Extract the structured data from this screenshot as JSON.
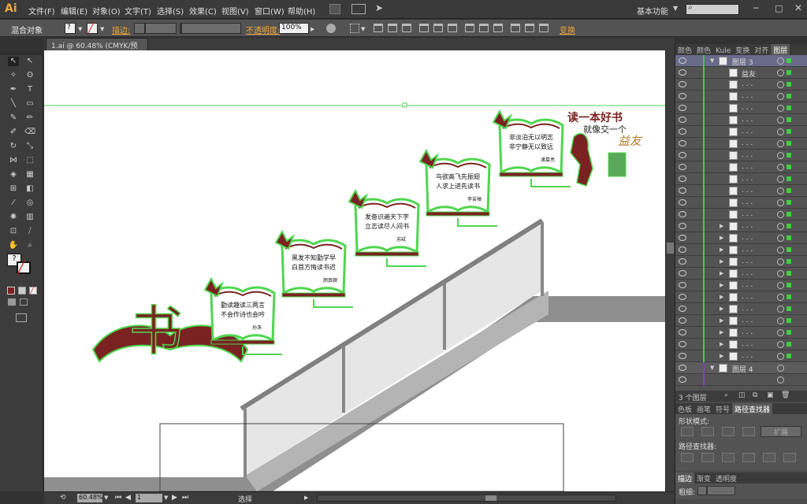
{
  "app": {
    "logo": "Ai",
    "accent": "#f0a63a",
    "workspace": "基本功能"
  },
  "menu": [
    "文件(F)",
    "编辑(E)",
    "对象(O)",
    "文字(T)",
    "选择(S)",
    "效果(C)",
    "视图(V)",
    "窗口(W)",
    "帮助(H)"
  ],
  "control": {
    "selection_type": "混合对象",
    "stroke_label": "描边:",
    "opacity_label": "不透明度:",
    "opacity_value": "100%",
    "transform_label": "变换"
  },
  "document_tab": "1.ai @ 60.48% (CMYK/预览)",
  "status": {
    "zoom": "60.48%",
    "artboard": "1",
    "tool": "选择"
  },
  "panel_tabs_top": [
    "颜色",
    "颜色",
    "Kule",
    "变换",
    "对齐",
    "图层"
  ],
  "layers": {
    "top_layer": {
      "name": "图层 3",
      "color": "#3cd03c"
    },
    "first_sublayer": "益友",
    "sublayer_placeholder": ". . .",
    "sublayer_count": 24,
    "bottom_layer": {
      "name": "图层 4",
      "color": "#8a3ad0"
    },
    "footer": "3 个图层"
  },
  "panel_tabs_mid": [
    "色板",
    "画笔",
    "符号",
    "路径查找器"
  ],
  "pathfinder": {
    "shape_modes": "形状模式:",
    "pathfinders": "路径查找器:",
    "expand": "扩展"
  },
  "panel_tabs_bottom": [
    "描边",
    "渐变",
    "透明度"
  ],
  "stroke_weight_label": "粗细:",
  "artwork": {
    "banner_line1": "读一本好书",
    "banner_line2": "就像交一个",
    "banner_line3": "益友",
    "big_char": "书",
    "plaques": [
      {
        "line1": "勤读趣读三两言",
        "line2": "不会作诗也会吟",
        "author": "孙洙"
      },
      {
        "line1": "黑发不知勤学早",
        "line2": "白首方悔读书迟",
        "author": "颜真卿"
      },
      {
        "line1": "发奋识遍天下字",
        "line2": "立志读尽人间书",
        "author": "苏轼"
      },
      {
        "line1": "鸟欲高飞先振翅",
        "line2": "人求上进先读书",
        "author": "李苦禅"
      },
      {
        "line1": "非淡泊无以明志",
        "line2": "非宁静无以致远",
        "author": "诸葛亮"
      }
    ]
  }
}
